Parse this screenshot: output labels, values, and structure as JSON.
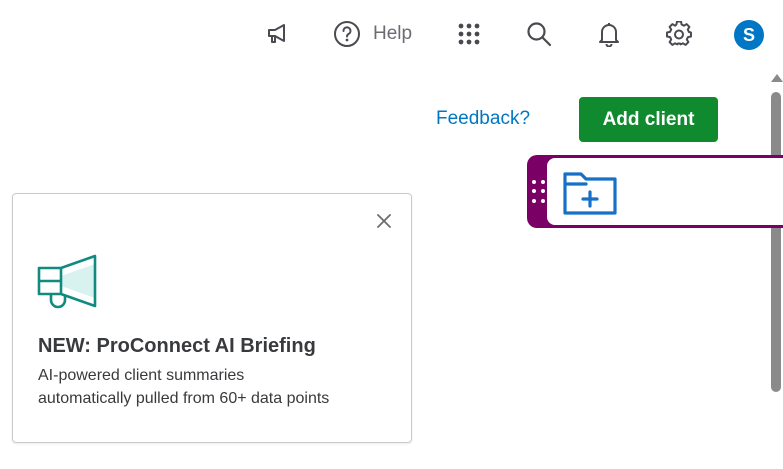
{
  "header": {
    "announcements_icon": "megaphone-icon",
    "help_label": "Help",
    "apps_icon": "apps-grid-icon",
    "search_icon": "search-icon",
    "notifications_icon": "bell-icon",
    "settings_icon": "gear-icon",
    "avatar_initial": "S",
    "avatar_color": "#0077c5"
  },
  "actions": {
    "feedback_label": "Feedback?",
    "add_client_label": "Add client",
    "add_client_color": "#108a2e"
  },
  "floating_widget": {
    "icon": "folder-plus-icon",
    "accent_color": "#7a0065"
  },
  "promo_card": {
    "icon": "megaphone-icon",
    "title": "NEW: ProConnect AI Briefing",
    "body": "AI-powered client summaries automatically pulled from 60+ data points"
  }
}
